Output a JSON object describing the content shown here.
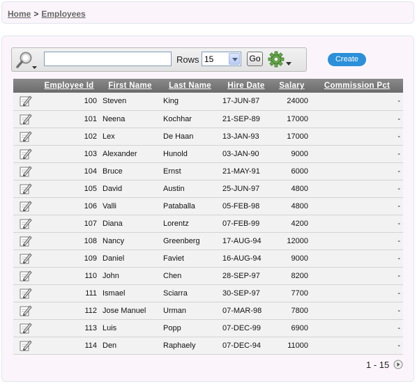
{
  "breadcrumb": {
    "home": "Home",
    "separator": ">",
    "current": "Employees"
  },
  "toolbar": {
    "search_value": "",
    "rows_label": "Rows",
    "rows_value": "15",
    "go_label": "Go",
    "create_label": "Create"
  },
  "columns": [
    "Employee Id",
    "First Name",
    "Last Name",
    "Hire Date",
    "Salary",
    "Commission Pct"
  ],
  "rows": [
    {
      "id": "100",
      "first": "Steven",
      "last": "King",
      "hire": "17-JUN-87",
      "salary": "24000",
      "comm": "-"
    },
    {
      "id": "101",
      "first": "Neena",
      "last": "Kochhar",
      "hire": "21-SEP-89",
      "salary": "17000",
      "comm": "-"
    },
    {
      "id": "102",
      "first": "Lex",
      "last": "De Haan",
      "hire": "13-JAN-93",
      "salary": "17000",
      "comm": "-"
    },
    {
      "id": "103",
      "first": "Alexander",
      "last": "Hunold",
      "hire": "03-JAN-90",
      "salary": "9000",
      "comm": "-"
    },
    {
      "id": "104",
      "first": "Bruce",
      "last": "Ernst",
      "hire": "21-MAY-91",
      "salary": "6000",
      "comm": "-"
    },
    {
      "id": "105",
      "first": "David",
      "last": "Austin",
      "hire": "25-JUN-97",
      "salary": "4800",
      "comm": "-"
    },
    {
      "id": "106",
      "first": "Valli",
      "last": "Pataballa",
      "hire": "05-FEB-98",
      "salary": "4800",
      "comm": "-"
    },
    {
      "id": "107",
      "first": "Diana",
      "last": "Lorentz",
      "hire": "07-FEB-99",
      "salary": "4200",
      "comm": "-"
    },
    {
      "id": "108",
      "first": "Nancy",
      "last": "Greenberg",
      "hire": "17-AUG-94",
      "salary": "12000",
      "comm": "-"
    },
    {
      "id": "109",
      "first": "Daniel",
      "last": "Faviet",
      "hire": "16-AUG-94",
      "salary": "9000",
      "comm": "-"
    },
    {
      "id": "110",
      "first": "John",
      "last": "Chen",
      "hire": "28-SEP-97",
      "salary": "8200",
      "comm": "-"
    },
    {
      "id": "111",
      "first": "Ismael",
      "last": "Sciarra",
      "hire": "30-SEP-97",
      "salary": "7700",
      "comm": "-"
    },
    {
      "id": "112",
      "first": "Jose Manuel",
      "last": "Urman",
      "hire": "07-MAR-98",
      "salary": "7800",
      "comm": "-"
    },
    {
      "id": "113",
      "first": "Luis",
      "last": "Popp",
      "hire": "07-DEC-99",
      "salary": "6900",
      "comm": "-"
    },
    {
      "id": "114",
      "first": "Den",
      "last": "Raphaely",
      "hire": "07-DEC-94",
      "salary": "11000",
      "comm": "-"
    }
  ],
  "pagination": {
    "range": "1 - 15"
  },
  "icons": {
    "search": "search-icon",
    "gear": "gear-icon",
    "edit": "edit-pencil-icon",
    "next": "next-page-icon"
  },
  "colors": {
    "accent": "#2b8fd9",
    "header_bg": "#7a7a7a",
    "row_bg": "#f2f2f2",
    "region_bg": "#fbf5fb"
  }
}
